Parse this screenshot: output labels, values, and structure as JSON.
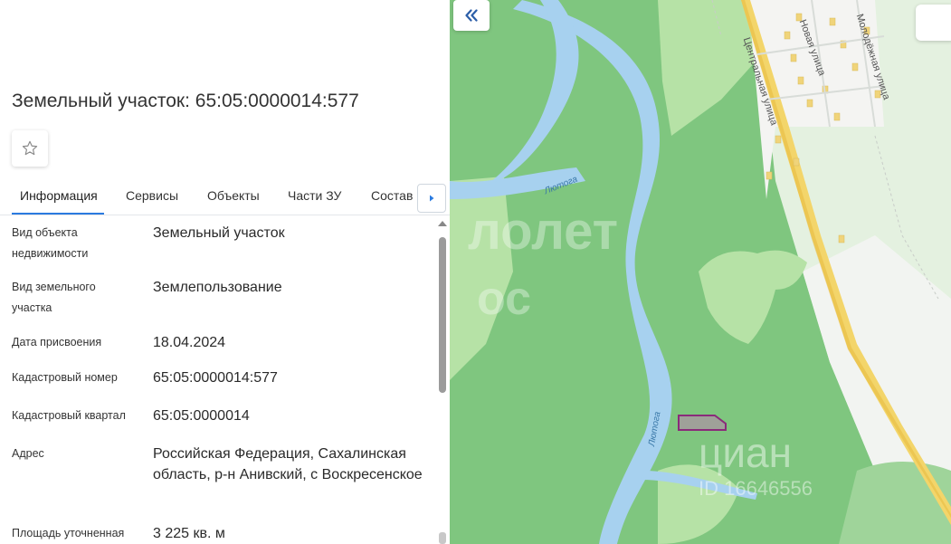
{
  "parcel": {
    "title": "Земельный участок: 65:05:0000014:577"
  },
  "tabs": [
    {
      "label": "Информация",
      "active": true
    },
    {
      "label": "Сервисы",
      "active": false
    },
    {
      "label": "Объекты",
      "active": false
    },
    {
      "label": "Части ЗУ",
      "active": false
    },
    {
      "label": "Состав",
      "active": false
    }
  ],
  "properties": [
    {
      "label": "Вид объекта недвижимости",
      "value": "Земельный участок"
    },
    {
      "label": "Вид земельного участка",
      "value": "Землепользование"
    },
    {
      "label": "Дата присвоения",
      "value": "18.04.2024"
    },
    {
      "label": "Кадастровый номер",
      "value": "65:05:0000014:577"
    },
    {
      "label": "Кадастровый квартал",
      "value": "65:05:0000014"
    },
    {
      "label": "Адрес",
      "value": "Российская Федерация, Сахалинская область, р-н Анивский, с Воскресенское"
    },
    {
      "label": "Площадь уточненная",
      "value": "3 225 кв. м"
    }
  ],
  "map": {
    "streets": [
      "Центральная улица",
      "Новая улица",
      "Молодёжная улица"
    ],
    "river": "Лютога",
    "watermarks": [
      "лолет",
      "ос",
      "циан",
      "ID 16646556"
    ]
  },
  "colors": {
    "accent": "#2b7be0",
    "forest": "#7fc67f",
    "meadow": "#b6e2a6",
    "river": "#a7d1ef",
    "road": "#f3d56a",
    "parcel": "#8a2b7a"
  },
  "icons": {
    "favorite": "star-outline-icon",
    "tabs_next": "chevron-right-icon",
    "collapse_panel": "double-chevron-left-icon"
  }
}
